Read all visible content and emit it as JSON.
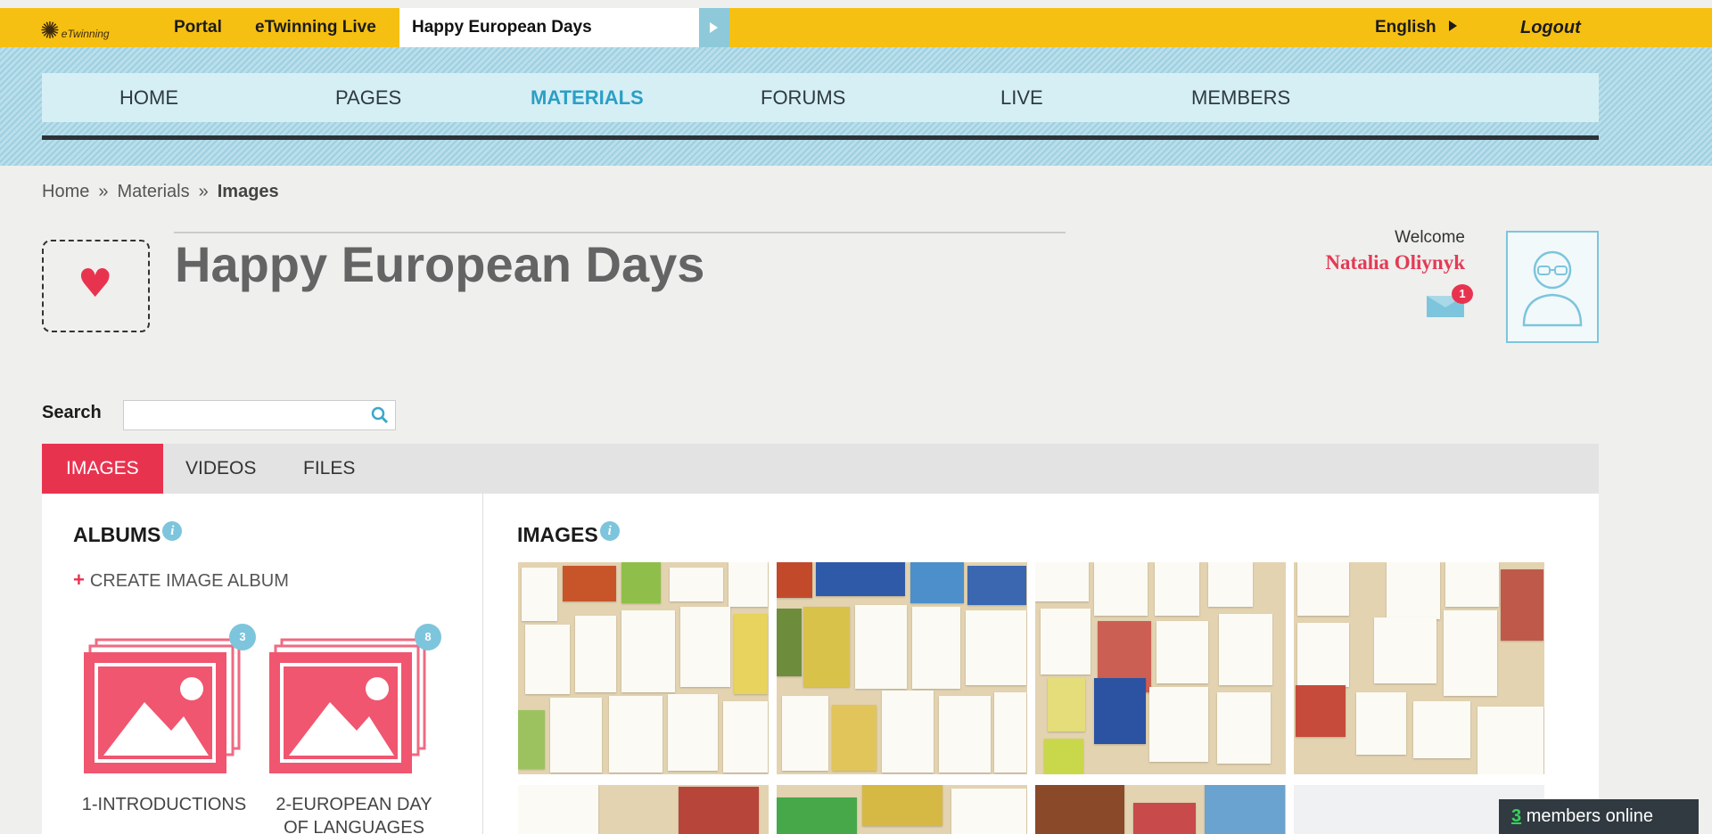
{
  "topbar": {
    "logo_text": "eTwinning",
    "portal": "Portal",
    "live": "eTwinning Live",
    "current": "Happy European Days",
    "language": "English",
    "logout": "Logout"
  },
  "nav": {
    "items": [
      "HOME",
      "PAGES",
      "MATERIALS",
      "FORUMS",
      "LIVE",
      "MEMBERS"
    ],
    "active": "MATERIALS"
  },
  "breadcrumb": {
    "home": "Home",
    "materials": "Materials",
    "current": "Images",
    "separator": "»"
  },
  "page": {
    "title": "Happy European Days",
    "welcome": "Welcome",
    "user_name": "Natalia Oliynyk",
    "unread_messages": "1"
  },
  "search": {
    "label": "Search",
    "value": ""
  },
  "tabs": [
    "IMAGES",
    "VIDEOS",
    "FILES"
  ],
  "albums": {
    "title": "ALBUMS",
    "create_label": "CREATE IMAGE ALBUM",
    "items": [
      {
        "name": "1-INTRODUCTIONS",
        "count": "3"
      },
      {
        "name": "2-EUROPEAN DAY",
        "name2": "OF LANGUAGES",
        "count": "8"
      }
    ]
  },
  "images": {
    "title": "IMAGES"
  },
  "footer": {
    "online_count": "3",
    "online_label": "members online"
  },
  "colors": {
    "topbar": "#f6c012",
    "accent_red": "#e8334f",
    "accent_blue": "#7dc5dc",
    "nav_active": "#2b9fc6"
  }
}
